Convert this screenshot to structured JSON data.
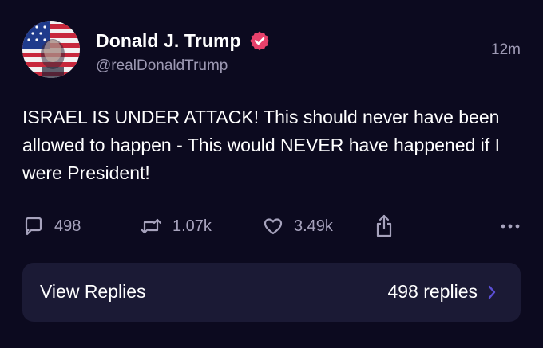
{
  "author": {
    "display_name": "Donald J. Trump",
    "handle": "@realDonaldTrump",
    "verified": true,
    "verified_badge_color": "#e8416b"
  },
  "post": {
    "timestamp": "12m",
    "text": "ISRAEL IS UNDER ATTACK! This should never have been allowed to happen - This would NEVER have happened if I were President!"
  },
  "actions": {
    "replies": "498",
    "reposts": "1.07k",
    "likes": "3.49k",
    "reply_icon": "speech-bubble-icon",
    "repost_icon": "repost-icon",
    "like_icon": "heart-icon",
    "share_icon": "share-icon",
    "more_icon": "more-dots-icon"
  },
  "replies_bar": {
    "label": "View Replies",
    "count": "498 replies",
    "chevron_color": "#5b4fd6"
  },
  "colors": {
    "background": "#0c0a1f",
    "secondary_text": "#9d99b3",
    "bar_background": "#1b1a35"
  }
}
